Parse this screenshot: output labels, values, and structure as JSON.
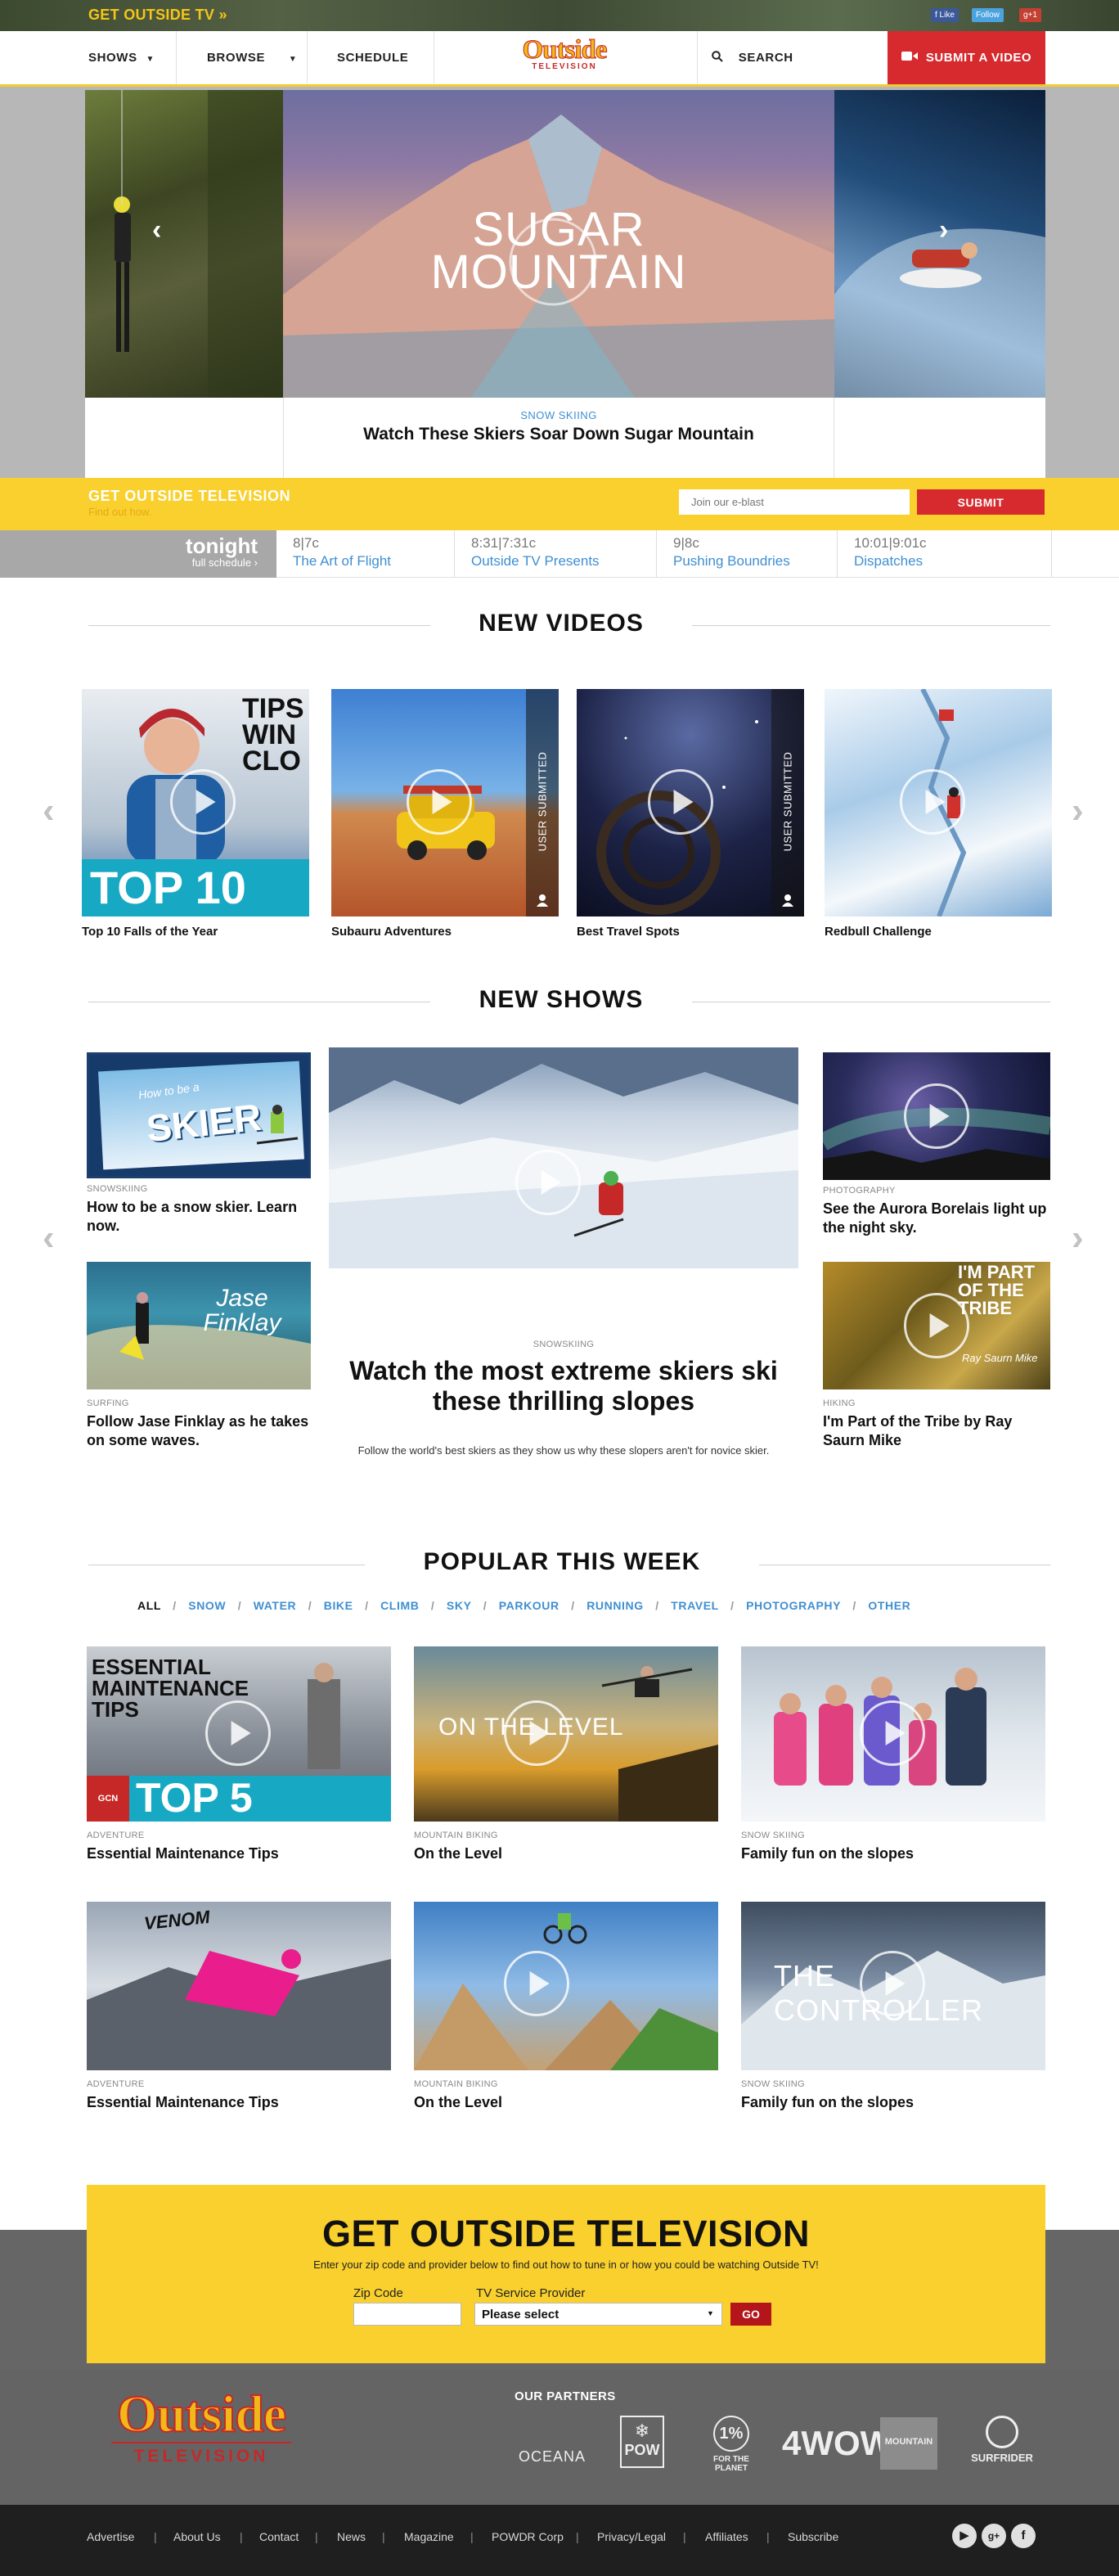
{
  "topbar": {
    "cta": "GET OUTSIDE TV",
    "cta_arrow": "»",
    "social": [
      "f Like",
      "Follow",
      "g+1"
    ]
  },
  "nav": {
    "shows": "SHOWS",
    "browse": "BROWSE",
    "schedule": "SCHEDULE",
    "logo_main": "Outside",
    "logo_sub": "TELEVISION",
    "search": "SEARCH",
    "submit": "SUBMIT A VIDEO"
  },
  "hero": {
    "overlay_line1": "SUGAR",
    "overlay_line2": "MOUNTAIN",
    "category": "SNOW SKIING",
    "title": "Watch These Skiers Soar Down Sugar Mountain"
  },
  "strip": {
    "title": "GET OUTSIDE TELEVISION",
    "subtitle": "Find out how.",
    "eblast_placeholder": "Join our e-blast",
    "submit": "SUBMIT"
  },
  "tonight": {
    "label": "tonight",
    "sub": "full schedule ›",
    "slots": [
      {
        "time": "8|7c",
        "show": "The Art of Flight"
      },
      {
        "time": "8:31|7:31c",
        "show": "Outside TV Presents"
      },
      {
        "time": "9|8c",
        "show": "Pushing Boundries"
      },
      {
        "time": "10:01|9:01c",
        "show": "Dispatches"
      }
    ]
  },
  "new_videos": {
    "heading": "NEW VIDEOS",
    "items": [
      {
        "title": "Top 10 Falls of the Year",
        "overlay": "TOP 10",
        "corner_text": "TIPS WIN CLO",
        "user_submitted": ""
      },
      {
        "title": "Subauru Adventures",
        "user_submitted": "USER SUBMITTED"
      },
      {
        "title": "Best Travel Spots",
        "user_submitted": "USER SUBMITTED"
      },
      {
        "title": "Redbull Challenge",
        "user_submitted": ""
      }
    ]
  },
  "new_shows": {
    "heading": "NEW SHOWS",
    "left": [
      {
        "category": "SNOWSKIING",
        "title": "How to be a snow skier. Learn now.",
        "art_text": "SKIER",
        "art_small": "How to be a"
      },
      {
        "category": "SURFING",
        "title": "Follow Jase Finklay as he takes on some waves.",
        "art_text": "Jase Finklay"
      }
    ],
    "featured": {
      "category": "SNOWSKIING",
      "title": "Watch the most extreme skiers ski these thrilling slopes",
      "description": "Follow the world's best skiers as they show us why these slopers aren't for novice skier."
    },
    "right": [
      {
        "category": "PHOTOGRAPHY",
        "title": "See the Aurora Borelais light up the night sky."
      },
      {
        "category": "HIKING",
        "title": "I'm Part of the Tribe by Ray Saurn Mike",
        "art_text": "I'M PART OF THE TRIBE",
        "art_small": "Ray Saurn Mike"
      }
    ]
  },
  "popular": {
    "heading": "POPULAR THIS WEEK",
    "filters": [
      "ALL",
      "SNOW",
      "WATER",
      "BIKE",
      "CLIMB",
      "SKY",
      "PARKOUR",
      "RUNNING",
      "TRAVEL",
      "PHOTOGRAPHY",
      "OTHER"
    ],
    "items": [
      {
        "category": "ADVENTURE",
        "title": "Essential Maintenance Tips",
        "art_text": "ESSENTIAL MAINTENANCE TIPS",
        "art_badge": "TOP 5",
        "art_small": "GCN"
      },
      {
        "category": "MOUNTAIN BIKING",
        "title": "On the Level",
        "art_text": "ON THE LEVEL"
      },
      {
        "category": "SNOW SKIING",
        "title": "Family fun on the slopes"
      },
      {
        "category": "ADVENTURE",
        "title": "Essential Maintenance Tips",
        "art_text": "VENOM"
      },
      {
        "category": "MOUNTAIN BIKING",
        "title": "On the Level"
      },
      {
        "category": "SNOW SKIING",
        "title": "Family fun on the slopes",
        "art_text": "THE CONTROLLER"
      }
    ]
  },
  "cta": {
    "title": "GET OUTSIDE TELEVISION",
    "subtitle": "Enter your zip code and provider below to find out how to tune in or how you could be watching Outside TV!",
    "zip_label": "Zip Code",
    "provider_label": "TV Service Provider",
    "provider_value": "Please select",
    "go": "GO"
  },
  "footer": {
    "logo_main": "Outside",
    "logo_sub": "TELEVISION",
    "partners_heading": "OUR PARTNERS",
    "partners": [
      "OCEANA",
      "POW",
      "FOR THE PLANET",
      "4WOW",
      "MOUNTAIN",
      "SURFRIDER"
    ],
    "links": [
      "Advertise",
      "About Us",
      "Contact",
      "News",
      "Magazine",
      "POWDR Corp",
      "Privacy/Legal",
      "Affiliates",
      "Subscribe"
    ],
    "social_icons": [
      "▶",
      "g+",
      "f"
    ]
  },
  "colors": {
    "brand_yellow": "#f9d02d",
    "brand_red": "#d62a2e",
    "link_blue": "#3f8fd2"
  }
}
